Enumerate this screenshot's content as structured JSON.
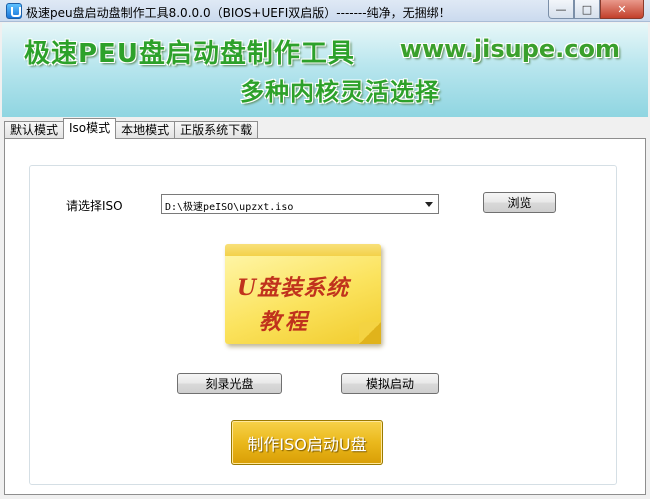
{
  "window": {
    "title": "极速peu盘启动盘制作工具8.0.0.0（BIOS+UEFI双启版）-------纯净，无捆绑！",
    "minimize": "—",
    "maximize": "□",
    "close": "✕"
  },
  "banner": {
    "title": "极速PEU盘启动盘制作工具",
    "url": "www.jisupe.com",
    "subtitle": "多种内核灵活选择"
  },
  "tabs": [
    {
      "label": "默认模式",
      "active": false
    },
    {
      "label": "Iso模式",
      "active": true
    },
    {
      "label": "本地模式",
      "active": false
    },
    {
      "label": "正版系统下载",
      "active": false
    }
  ],
  "iso": {
    "label": "请选择ISO",
    "selected": "D:\\极速peISO\\upzxt.iso",
    "browse_label": "浏览"
  },
  "tutorial_note": {
    "line1": "U盘装系统",
    "line2": "教程"
  },
  "actions": {
    "burn_label": "刻录光盘",
    "simulate_label": "模拟启动",
    "make_label": "制作ISO启动U盘"
  },
  "colors": {
    "banner_text": "#2da12a",
    "note_text": "#c0321d",
    "make_button": "#eab81c"
  }
}
